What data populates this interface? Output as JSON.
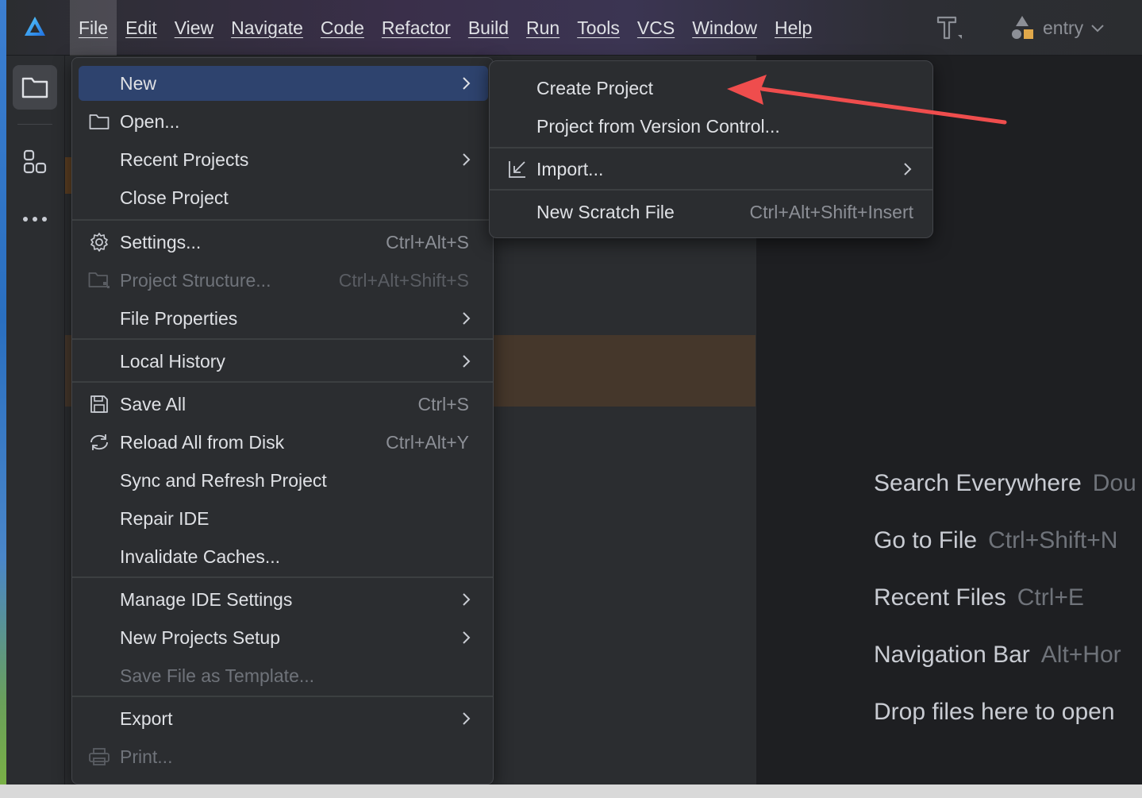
{
  "menubar": {
    "items": [
      "File",
      "Edit",
      "View",
      "Navigate",
      "Code",
      "Refactor",
      "Build",
      "Run",
      "Tools",
      "VCS",
      "Window",
      "Help"
    ],
    "active": "File"
  },
  "toolbar": {
    "run_config": "entry"
  },
  "file_menu": {
    "new": "New",
    "open": "Open...",
    "recent_projects": "Recent Projects",
    "close_project": "Close Project",
    "settings": "Settings...",
    "settings_shortcut": "Ctrl+Alt+S",
    "project_structure": "Project Structure...",
    "project_structure_shortcut": "Ctrl+Alt+Shift+S",
    "file_properties": "File Properties",
    "local_history": "Local History",
    "save_all": "Save All",
    "save_all_shortcut": "Ctrl+S",
    "reload_all": "Reload All from Disk",
    "reload_all_shortcut": "Ctrl+Alt+Y",
    "sync_refresh": "Sync and Refresh Project",
    "repair_ide": "Repair IDE",
    "invalidate_caches": "Invalidate Caches...",
    "manage_ide_settings": "Manage IDE Settings",
    "new_projects_setup": "New Projects Setup",
    "save_file_as_template": "Save File as Template...",
    "export": "Export",
    "print": "Print..."
  },
  "new_submenu": {
    "create_project": "Create Project",
    "project_from_vcs": "Project from Version Control...",
    "import": "Import...",
    "new_scratch_file": "New Scratch File",
    "new_scratch_file_shortcut": "Ctrl+Alt+Shift+Insert"
  },
  "editor_hints": [
    {
      "label": "Search Everywhere",
      "key": "Dou"
    },
    {
      "label": "Go to File",
      "key": "Ctrl+Shift+N"
    },
    {
      "label": "Recent Files",
      "key": "Ctrl+E"
    },
    {
      "label": "Navigation Bar",
      "key": "Alt+Hor"
    },
    {
      "label": "Drop files here to open",
      "key": ""
    }
  ],
  "colors": {
    "menu_bg": "#2b2d30",
    "selected_bg": "#2e436e",
    "annotation_arrow": "#ef4d4d",
    "brand_logo": "#3fa9f5"
  },
  "icons": {
    "app_logo": "huawei-devtools-logo-icon",
    "build": "hammer-icon",
    "project_tool": "folder-icon",
    "structure_tool": "structure-icon",
    "more_tools": "more-dots-icon"
  }
}
